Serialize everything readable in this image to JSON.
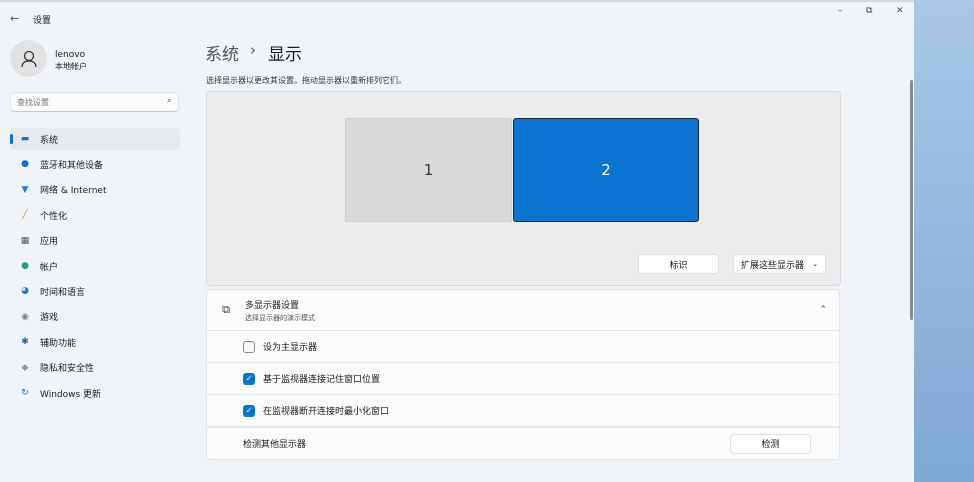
{
  "window": {
    "title": "设置",
    "back": "←",
    "minimize": "–",
    "restore": "⧉",
    "close": "✕"
  },
  "user": {
    "name": "lenovo",
    "type": "本地帐户"
  },
  "search": {
    "placeholder": "查找设置"
  },
  "sidebar": {
    "items": [
      {
        "label": "系统",
        "icon": "monitor-icon",
        "glyph": "▬",
        "color": "#1f6fb5"
      },
      {
        "label": "蓝牙和其他设备",
        "icon": "bluetooth-icon",
        "glyph": "●",
        "color": "#0a74d0"
      },
      {
        "label": "网络 & Internet",
        "icon": "wifi-icon",
        "glyph": "▼",
        "color": "#1a7fd8"
      },
      {
        "label": "个性化",
        "icon": "brush-icon",
        "glyph": "╱",
        "color": "#d08a2a"
      },
      {
        "label": "应用",
        "icon": "apps-icon",
        "glyph": "▦",
        "color": "#4a5560"
      },
      {
        "label": "帐户",
        "icon": "account-icon",
        "glyph": "●",
        "color": "#1fa36a"
      },
      {
        "label": "时间和语言",
        "icon": "globe-clock-icon",
        "glyph": "◕",
        "color": "#1a7fd8"
      },
      {
        "label": "游戏",
        "icon": "gamepad-icon",
        "glyph": "◉",
        "color": "#7a8690"
      },
      {
        "label": "辅助功能",
        "icon": "accessibility-icon",
        "glyph": "✱",
        "color": "#1f5fb0"
      },
      {
        "label": "隐私和安全性",
        "icon": "shield-icon",
        "glyph": "◆",
        "color": "#8a96a0"
      },
      {
        "label": "Windows 更新",
        "icon": "update-icon",
        "glyph": "↻",
        "color": "#0a74d0"
      }
    ]
  },
  "header": {
    "parent": "系统",
    "sep": "›",
    "title": "显示"
  },
  "hint": "选择显示器以更改其设置。拖动显示器以重新排列它们。",
  "monitors": [
    {
      "label": "1"
    },
    {
      "label": "2",
      "selected": true
    }
  ],
  "buttons": {
    "identify": "标识",
    "extend": "扩展这些显示器"
  },
  "multi": {
    "title": "多显示器设置",
    "subtitle": "选择显示器的演示模式",
    "options": [
      {
        "label": "设为主显示器",
        "checked": false
      },
      {
        "label": "基于监视器连接记住窗口位置",
        "checked": true
      },
      {
        "label": "在监视器断开连接时最小化窗口",
        "checked": true
      }
    ],
    "detect_label": "检测其他显示器",
    "detect_button": "检测"
  },
  "colors": {
    "accent": "#0a74d0"
  }
}
